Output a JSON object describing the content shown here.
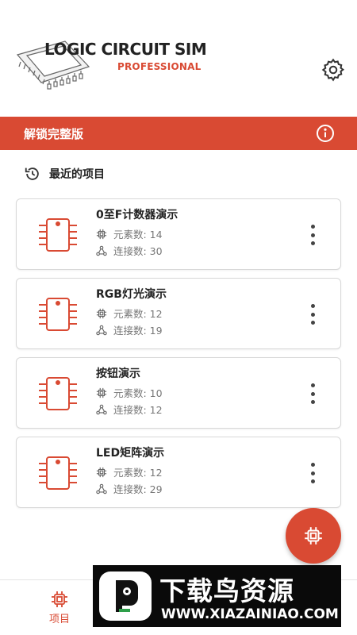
{
  "header": {
    "logo_title": "LOGIC CIRCUIT SIM",
    "logo_subtitle": "PROFESSIONAL",
    "settings_icon": "gear-icon"
  },
  "banner": {
    "text": "解锁完整版",
    "icon": "info-icon",
    "color": "#d94a33"
  },
  "recent": {
    "label": "最近的项目",
    "icon": "history-icon"
  },
  "projects": [
    {
      "title": "0至F计数器演示",
      "elements_label": "元素数: 14",
      "connections_label": "连接数: 30"
    },
    {
      "title": "RGB灯光演示",
      "elements_label": "元素数: 12",
      "connections_label": "连接数: 19"
    },
    {
      "title": "按钮演示",
      "elements_label": "元素数: 10",
      "connections_label": "连接数: 12"
    },
    {
      "title": "LED矩阵演示",
      "elements_label": "元素数: 12",
      "connections_label": "连接数: 29"
    }
  ],
  "fab": {
    "icon": "chip-icon"
  },
  "bottom_nav": {
    "items": [
      {
        "label": "项目",
        "icon": "chip-icon",
        "active": true
      }
    ]
  },
  "watermark": {
    "title": "下载鸟资源",
    "url": "WWW.XIAZAINIAO.COM"
  }
}
